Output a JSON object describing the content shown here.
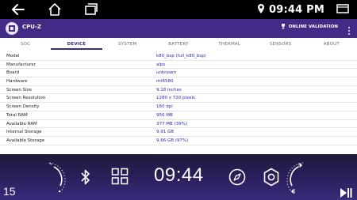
{
  "status_bar": {
    "time": "09:44 PM",
    "icons": [
      "back-icon",
      "home-icon",
      "recents-icon",
      "location-icon",
      "window-icon"
    ]
  },
  "app": {
    "title": "CPU-Z",
    "validation_label": "ONLINE VALIDATION",
    "accent_color": "#432a86"
  },
  "tabs": [
    {
      "label": "SOC"
    },
    {
      "label": "DEVICE",
      "active": true
    },
    {
      "label": "SYSTEM"
    },
    {
      "label": "BATTERY"
    },
    {
      "label": "THERMAL"
    },
    {
      "label": "SENSORS"
    },
    {
      "label": "ABOUT"
    }
  ],
  "device_info": [
    {
      "key": "Model",
      "value": "k80_bsp (full_k80_bsp)"
    },
    {
      "key": "Manufacturer",
      "value": "alps"
    },
    {
      "key": "Board",
      "value": "unknown"
    },
    {
      "key": "Hardware",
      "value": "mt6580"
    },
    {
      "key": "Screen Size",
      "value": "9.18 inches"
    },
    {
      "key": "Screen Resolution",
      "value": "1280 x 720 pixels"
    },
    {
      "key": "Screen Density",
      "value": "160 dpi"
    },
    {
      "key": "Total RAM",
      "value": "956 MB"
    },
    {
      "key": "Available RAM",
      "value": "377 MB  (39%)"
    },
    {
      "key": "Internal Storage",
      "value": "9.91 GB"
    },
    {
      "key": "Available Storage",
      "value": "9.66 GB (97%)"
    }
  ],
  "dock": {
    "page_number": "15",
    "clock": "09:44",
    "icons": [
      "bluetooth-icon",
      "apps-grid-icon",
      "compass-icon",
      "settings-icon",
      "play-pause-icon"
    ]
  }
}
